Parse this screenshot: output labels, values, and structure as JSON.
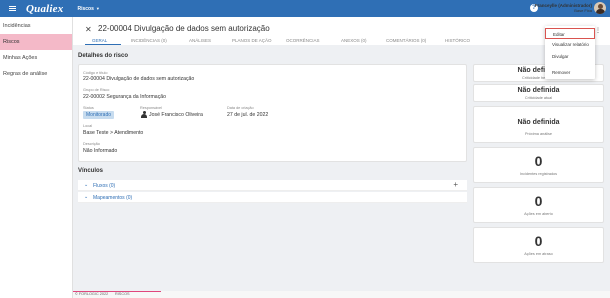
{
  "app": {
    "logo": "Qualiex",
    "module": "Riscos",
    "help_icon": "?"
  },
  "user": {
    "name": "Franceylle (Administrador)",
    "unit": "Base Fixa"
  },
  "sidebar": {
    "items": [
      {
        "label": "Incidências",
        "active": false
      },
      {
        "label": "Riscos",
        "active": true
      },
      {
        "label": "Minhas Ações",
        "active": false
      },
      {
        "label": "Regras de análise",
        "active": false
      }
    ]
  },
  "header": {
    "close_icon": "✕",
    "title": "22-00004 Divulgação de dados sem autorização",
    "kebab_icon": "⋮"
  },
  "tabs": [
    "GERAL",
    "INCIDÊNCIAS (0)",
    "ANÁLISES",
    "PLANOS DE AÇÃO",
    "OCORRÊNCIAS",
    "ANEXOS (0)",
    "COMENTÁRIOS (0)",
    "HISTÓRICO"
  ],
  "details": {
    "section_title": "Detalhes do risco",
    "code_label": "Código e título",
    "code_value": "22-00004 Divulgação de dados sem autorização",
    "group_label": "Grupo de Risco",
    "group_value": "22-00002 Segurança da Informação",
    "status_label": "Status",
    "status_value": "Monitorado",
    "responsible_label": "Responsável",
    "responsible_value": "José Francisco Oliveira",
    "created_label": "Data de criação",
    "created_value": "27 de jul. de 2022",
    "location_label": "Local",
    "location_value": "Base Teste > Atendimento",
    "description_label": "Descrição",
    "description_value": "Não Informado"
  },
  "links": {
    "section_title": "Vínculos",
    "plus_icon": "+",
    "chevron_icon": "⌄",
    "rows": [
      "Fluxos (0)",
      "Mapeamentos (0)"
    ]
  },
  "stats": [
    {
      "value": "Não definida",
      "label": "Criticidade herdada"
    },
    {
      "value": "Não definida",
      "label": "Criticidade atual"
    },
    {
      "value": "Não definida",
      "label": "Próxima análise"
    },
    {
      "value": "0",
      "label": "Incidentes registrados"
    },
    {
      "value": "0",
      "label": "Ações em aberto"
    },
    {
      "value": "0",
      "label": "Ações em atraso"
    }
  ],
  "dropdown": [
    "Editar",
    "Visualizar relatório",
    "Divulgar",
    "Remover"
  ],
  "footer": {
    "copyright": "© FORLOGIC 2022",
    "section": "RISCOS"
  },
  "colors": {
    "primary": "#2f6fb5",
    "sidebar_active": "#f4b9c8",
    "accent": "#e0477d"
  }
}
